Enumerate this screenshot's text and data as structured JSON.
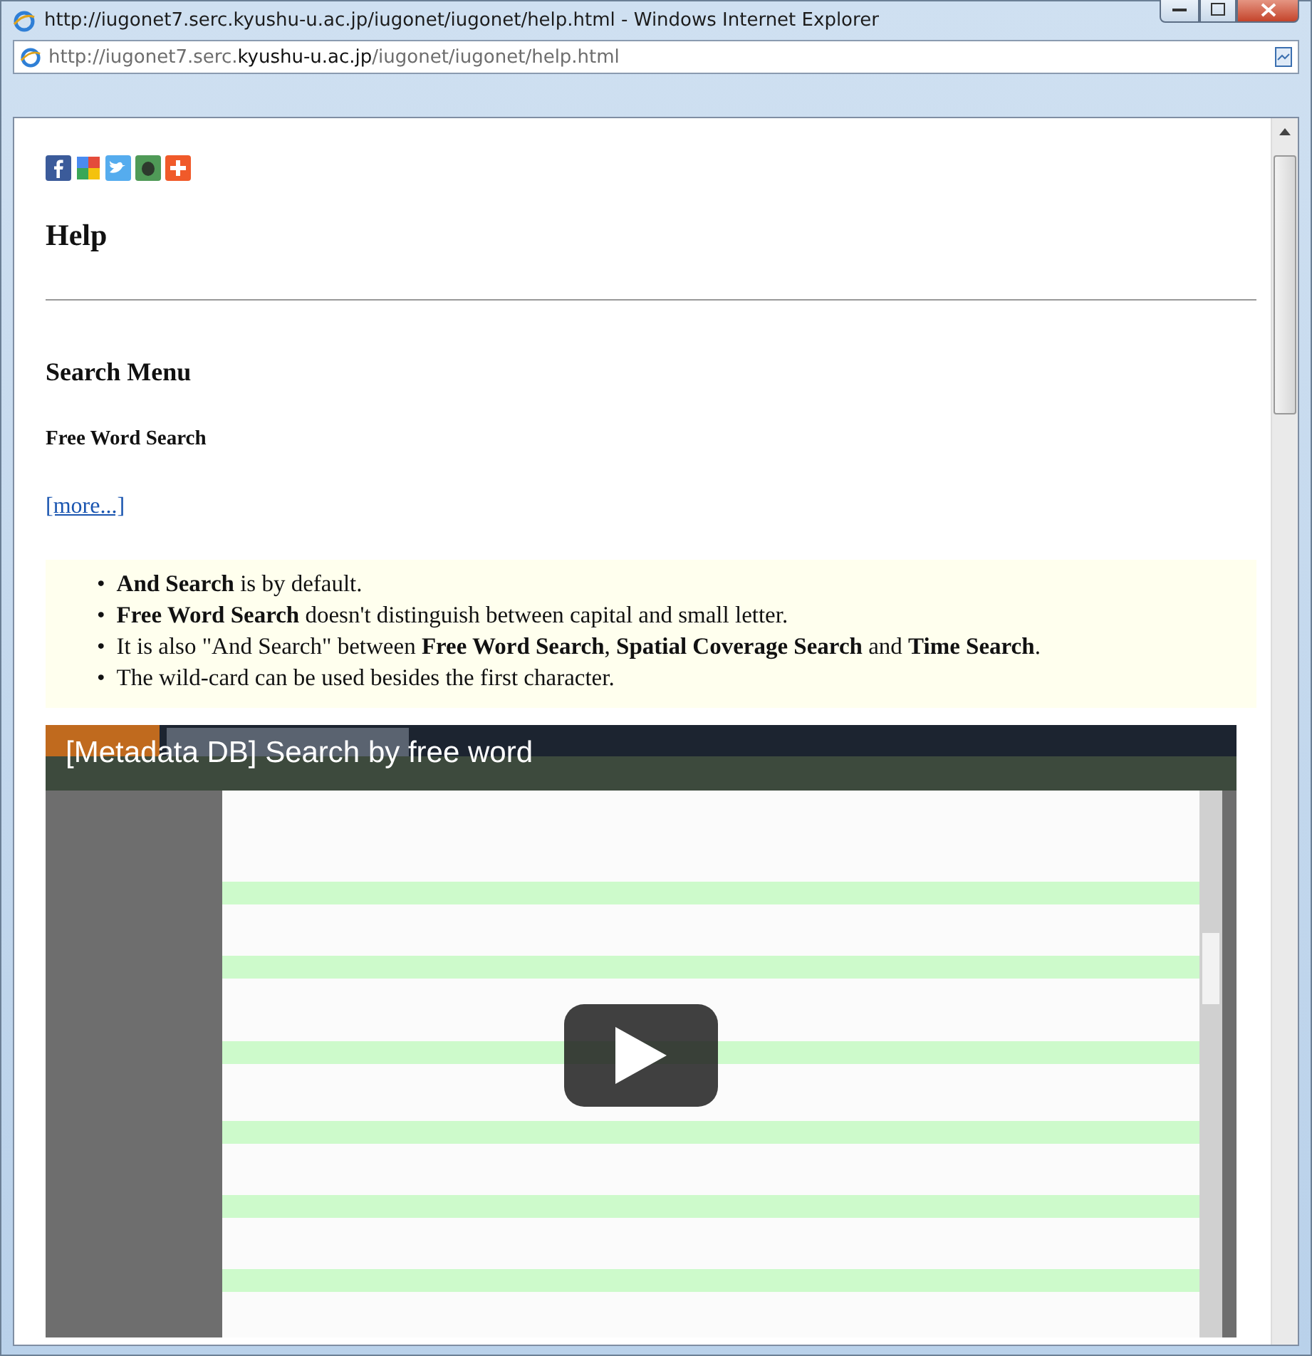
{
  "window": {
    "title": "http://iugonet7.serc.kyushu-u.ac.jp/iugonet/iugonet/help.html - Windows Internet Explorer"
  },
  "address_bar": {
    "prefix": "http://iugonet7.serc.",
    "domain": "kyushu-u.ac.jp",
    "path": "/iugonet/iugonet/help.html"
  },
  "share_icons": [
    {
      "kind": "facebook"
    },
    {
      "kind": "google"
    },
    {
      "kind": "twitter"
    },
    {
      "kind": "evernote"
    },
    {
      "kind": "plus"
    }
  ],
  "page": {
    "title": "Help",
    "section": "Search Menu",
    "subsection": "Free Word Search",
    "more_link": "[more...]",
    "notes": [
      {
        "marker": "•",
        "text": "**And Search** is by default."
      },
      {
        "marker": "•",
        "text": "**Free Word Search** doesn't distinguish between capital and small letter."
      },
      {
        "marker": "•",
        "text": "It is also \"And Search\" between **Free Word Search**, **Spatial Coverage Search** and **Time Search**."
      },
      {
        "marker": "•",
        "text": "The wild-card can be used besides the first character."
      }
    ],
    "video": {
      "title": "[Metadata DB] Search by free word",
      "kind": "picture"
    }
  }
}
